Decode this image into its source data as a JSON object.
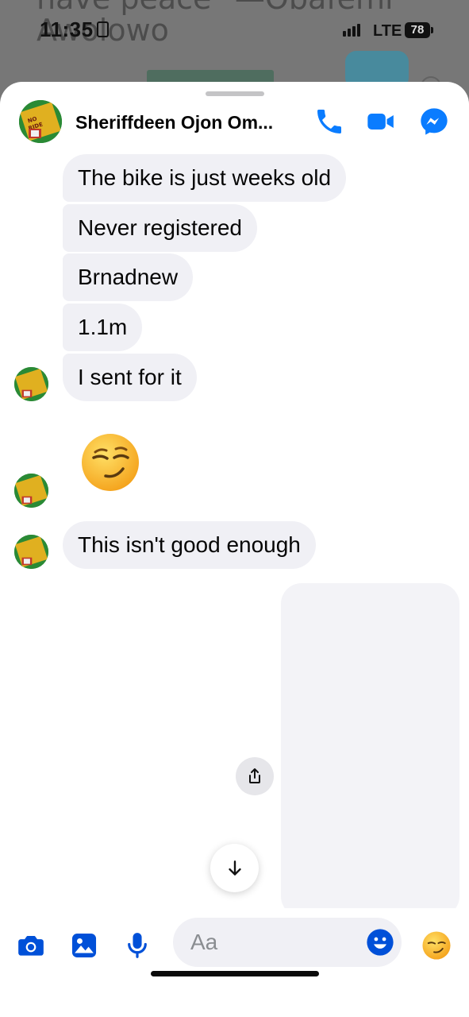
{
  "backdrop": {
    "quote_line1": "have peace\" —Obafemi",
    "quote_line2": "Awolowo"
  },
  "status_bar": {
    "time": "11:35",
    "network": "LTE",
    "battery": "78"
  },
  "header": {
    "contact_name": "Sheriffdeen Ojon Om...",
    "icons": [
      "phone-icon",
      "video-call-icon",
      "messenger-icon"
    ]
  },
  "messages": [
    {
      "text": "The bike is just weeks old"
    },
    {
      "text": "Never registered"
    },
    {
      "text": "Brnadnew"
    },
    {
      "text": "1.1m"
    },
    {
      "text": "I sent for it"
    },
    {
      "emoji": "smirking-face-emoji"
    },
    {
      "text": "This isn't good enough"
    }
  ],
  "composer": {
    "placeholder": "Aa",
    "icons": [
      "camera-icon",
      "gallery-icon",
      "microphone-icon",
      "emoji-picker-icon",
      "smirk-reaction-icon"
    ]
  },
  "colors": {
    "accent": "#0a7cff",
    "bubble": "#f0f0f5",
    "text": "#050505"
  }
}
